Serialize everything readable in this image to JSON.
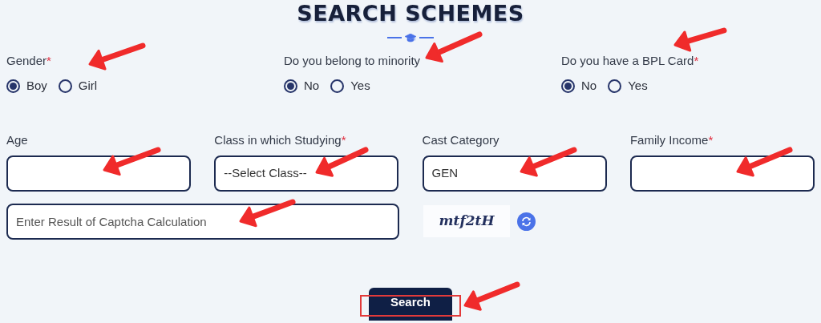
{
  "title": "SEARCH SCHEMES",
  "radio_groups": [
    {
      "label": "Gender",
      "required_mark": "*",
      "options": [
        {
          "label": "Boy",
          "selected": true
        },
        {
          "label": "Girl",
          "selected": false
        }
      ]
    },
    {
      "label": "Do you belong to minority",
      "options": [
        {
          "label": "No",
          "selected": true
        },
        {
          "label": "Yes",
          "selected": false
        }
      ]
    },
    {
      "label": "Do you have a BPL Card",
      "required_mark": "*",
      "options": [
        {
          "label": "No",
          "selected": true
        },
        {
          "label": "Yes",
          "selected": false
        }
      ]
    }
  ],
  "fields": [
    {
      "label": "Age"
    },
    {
      "label": "Class in which Studying",
      "required_mark": "*",
      "value": "--Select Class--"
    },
    {
      "label": "Cast Category",
      "value": "GEN"
    },
    {
      "label": "Family Income",
      "required_mark": "*"
    }
  ],
  "captcha": {
    "placeholder": "Enter Result of Captcha Calculation",
    "code": "mtf2tH"
  },
  "search_button": {
    "label": "Search",
    "highlighted": true
  }
}
